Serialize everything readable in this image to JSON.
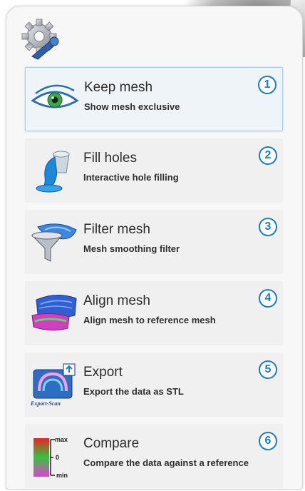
{
  "menu": {
    "items": [
      {
        "number": "1",
        "title": "Keep mesh",
        "subtitle": "Show mesh exclusive",
        "icon": "eye-icon",
        "selected": true
      },
      {
        "number": "2",
        "title": "Fill holes",
        "subtitle": "Interactive hole filling",
        "icon": "paint-bucket-icon",
        "selected": false
      },
      {
        "number": "3",
        "title": "Filter mesh",
        "subtitle": "Mesh smoothing filter",
        "icon": "funnel-icon",
        "selected": false
      },
      {
        "number": "4",
        "title": "Align mesh",
        "subtitle": "Align mesh to reference mesh",
        "icon": "align-mesh-icon",
        "selected": false
      },
      {
        "number": "5",
        "title": "Export",
        "subtitle": "Export the data as STL",
        "icon": "export-scan-icon",
        "selected": false
      },
      {
        "number": "6",
        "title": "Compare",
        "subtitle": "Compare the data against a reference",
        "icon": "color-scale-icon",
        "selected": false
      }
    ]
  },
  "icons": {
    "settings": "gear-wrench-icon",
    "export_caption": "Export-Scan",
    "scale_labels": {
      "max": "max",
      "zero": "0",
      "min": "min"
    }
  },
  "colors": {
    "number_badge": "#1e7cc6",
    "selected_border": "#a9cfe6",
    "item_background": "#f0f0f0"
  }
}
